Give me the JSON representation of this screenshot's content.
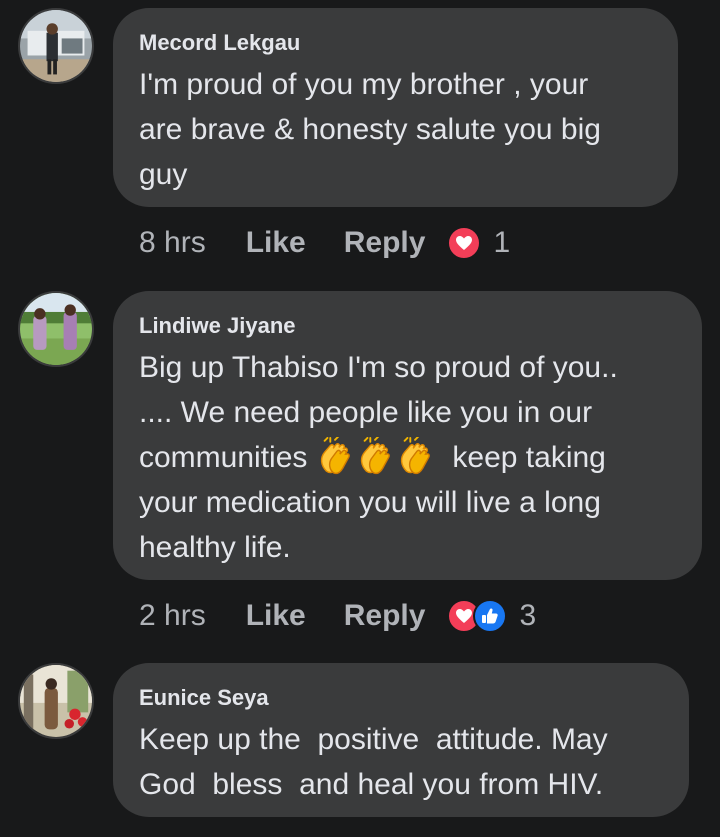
{
  "comments": [
    {
      "author": "Mecord Lekgau",
      "text": "I'm proud of you my brother , your\nare brave & honesty salute you big\nguy",
      "time": "8 hrs",
      "like_label": "Like",
      "reply_label": "Reply",
      "reactions": [
        "heart-icon"
      ],
      "reaction_count": "1"
    },
    {
      "author": "Lindiwe Jiyane",
      "text_lines": [
        "Big up Thabiso I'm so proud of you..",
        ".... We need people like you in our",
        "communities",
        "keep taking",
        "your medication you will live a long",
        "healthy life."
      ],
      "emojis": [
        "clapping-hands-icon",
        "clapping-hands-icon",
        "clapping-hands-icon"
      ],
      "time": "2 hrs",
      "like_label": "Like",
      "reply_label": "Reply",
      "reactions": [
        "heart-icon",
        "thumbs-up-icon"
      ],
      "reaction_count": "3"
    },
    {
      "author": "Eunice Seya",
      "text": "Keep up the  positive  attitude. May\nGod  bless  and heal you from HIV."
    }
  ],
  "colors": {
    "background": "#18191a",
    "bubble": "#3a3b3c",
    "text": "#e4e6eb",
    "muted": "#b0b3b8",
    "love": "#f33e58",
    "like": "#1877f2"
  }
}
